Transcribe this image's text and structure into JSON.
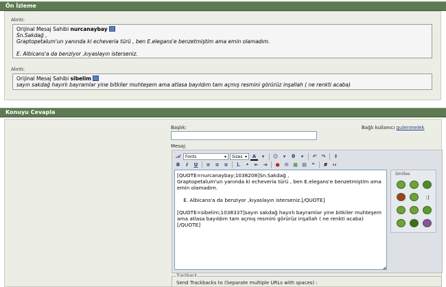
{
  "preview": {
    "header": "Ön İzleme",
    "quotes": [
      {
        "label": "Alıntı:",
        "prefix": "Orijinal Mesaj Sahibi ",
        "author": "nurcanaybay",
        "lines": [
          "Sn.Sakdağ ,",
          "Graptopetalum'un yanında ki echeveria türü , ben E.elegans'e benzetmiştim ama emin olamadım.",
          "",
          "E. Albicans'a da benziyor ,kıyaslayın isterseniz."
        ]
      },
      {
        "label": "Alıntı:",
        "prefix": "Orijinal Mesaj Sahibi ",
        "author": "sibelim",
        "lines": [
          "sayın sakdağ hayırlı bayramlar yine bitkiler muhteşem ama atlasa bayıldım tam açmış resmini görürüz inşallah ( ne renkti acaba)"
        ]
      }
    ]
  },
  "reply": {
    "header": "Konuyu Cevapla",
    "title_label": "Başlık:",
    "logged_in_prefix": "Bağlı kullanıcı ",
    "logged_in_user": "gulenmelek",
    "message_label": "Mesaj:",
    "toolbar": {
      "font": "Fonts",
      "size": "Sizes",
      "color": "A",
      "row1_icons": [
        "A",
        "▾",
        "☺",
        "▾",
        "ǫ",
        "▾",
        "↶",
        "↷",
        "⇕"
      ],
      "row2_icons": [
        "B",
        "I",
        "U",
        "≡",
        "≡",
        "≡",
        "≣",
        "≣",
        "⇥",
        "⇤",
        "🔗",
        "✉",
        "▦",
        "▤",
        "❝",
        "#",
        "<>"
      ]
    },
    "message_text": "[QUOTE=nurcanaybay;1038208]Sn.Sakdağ ,\nGraptopetalum'un yanında ki echeveria türü , ben E.elegans'e benzetmiştim ama emin olamadım.\n\n    E. Albicans'a da benziyor ,kıyaslayın isterseniz.[/QUOTE]\n\n[QUOTE=sibelim;1038337]sayın sakdağ hayırlı bayramlar yine bitkiler muhteşem ama atlasa bayıldım tam açmış resmini görürüz inşallah ( ne renkti acaba)\n[/QUOTE]",
    "smilies_caption": "Smilies",
    "trackback_legend": "Trackback",
    "trackback_text": "Send Trackbacks to (Separate multiple URLs with spaces) :"
  }
}
